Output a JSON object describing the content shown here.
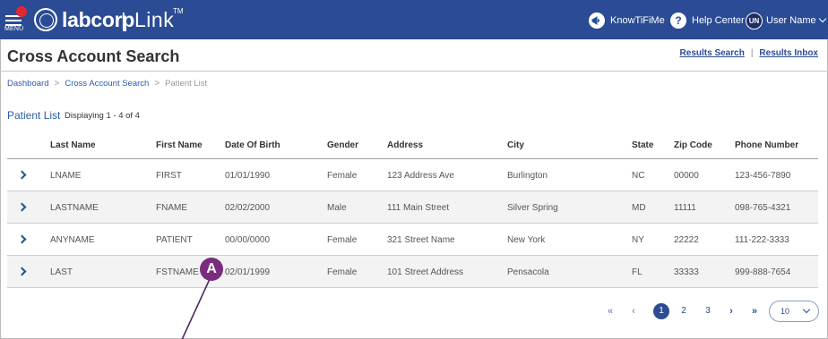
{
  "header": {
    "menu_label": "MENU",
    "logo_text": "labcorp",
    "logo_sep": "|",
    "product": "Link",
    "tm": "TM",
    "knowtifime": "KnowTiFiMe",
    "help_center": "Help Center",
    "help_glyph": "?",
    "user_initials": "UN",
    "user_name": "User Name"
  },
  "page": {
    "title": "Cross Account Search",
    "links": [
      "Results Search",
      "Results Inbox"
    ],
    "link_sep": "|"
  },
  "breadcrumb": {
    "items": [
      "Dashboard",
      "Cross Account Search",
      "Patient List"
    ],
    "sep": ">"
  },
  "patient_list": {
    "title": "Patient List",
    "count": "Displaying 1 - 4 of 4"
  },
  "table": {
    "columns": [
      "Last Name",
      "First Name",
      "Date Of Birth",
      "Gender",
      "Address",
      "City",
      "State",
      "Zip Code",
      "Phone Number"
    ],
    "rows": [
      [
        "LNAME",
        "FIRST",
        "01/01/1990",
        "Female",
        "123 Address Ave",
        "Burlington",
        "NC",
        "00000",
        "123-456-7890"
      ],
      [
        "LASTNAME",
        "FNAME",
        "02/02/2000",
        "Male",
        "111 Main Street",
        "Silver Spring",
        "MD",
        "11111",
        "098-765-4321"
      ],
      [
        "ANYNAME",
        "PATIENT",
        "00/00/0000",
        "Female",
        "321 Street Name",
        "New York",
        "NY",
        "22222",
        "111-222-3333"
      ],
      [
        "LAST",
        "FSTNAME",
        "02/01/1999",
        "Female",
        "101 Street Address",
        "Pensacola",
        "FL",
        "33333",
        "999-888-7654"
      ]
    ]
  },
  "pagination": {
    "first": "«",
    "prev": "‹",
    "pages": [
      "1",
      "2",
      "3"
    ],
    "current": "1",
    "next": "›",
    "last": "»",
    "per_page": "10"
  },
  "callout": {
    "label": "A"
  },
  "colors": {
    "header_bg": "#2b4c94",
    "link": "#2b5cab",
    "callout": "#7b2c7f",
    "menu_dot": "#e3262d"
  },
  "icons": {
    "menu": "hamburger-icon",
    "knowtifime": "megaphone-icon",
    "help": "question-icon",
    "row_expand": "chevron-right-icon"
  }
}
